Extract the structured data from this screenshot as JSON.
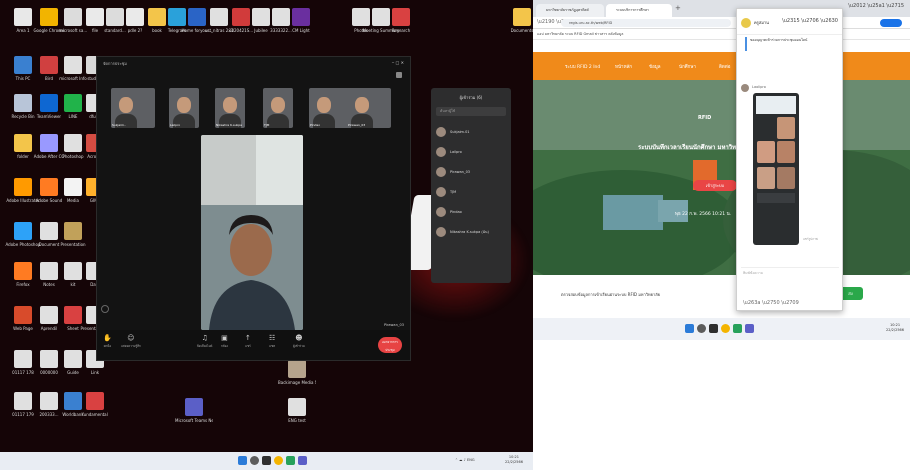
{
  "desktop_icons": [
    {
      "label": "Area 1",
      "color": "#e8e8e8"
    },
    {
      "label": "Google Chrome",
      "color": "#f2b400"
    },
    {
      "label": "microsoft sa...",
      "color": "#dcdcdc"
    },
    {
      "label": "file",
      "color": "#eaeaea"
    },
    {
      "label": "standard...",
      "color": "#dcdcdc"
    },
    {
      "label": "pdle 2?",
      "color": "#eaeaea"
    },
    {
      "label": "book",
      "color": "#f3c54a"
    },
    {
      "label": "Telegram",
      "color": "#2aa1da"
    },
    {
      "label": "Home foryour...",
      "color": "#2a64c6"
    },
    {
      "label": "ust_nitras 2x3",
      "color": "#e0e0e0"
    },
    {
      "label": "1020421S...",
      "color": "#d13b3b"
    },
    {
      "label": "Jubilee",
      "color": "#e0e0e0"
    },
    {
      "label": "3333322...",
      "color": "#e0e0e0"
    },
    {
      "label": "CM Light",
      "color": "#6a2f9f"
    },
    {
      "label": "This PC",
      "color": "#3a80d0"
    },
    {
      "label": "Bird",
      "color": "#d04040"
    },
    {
      "label": "microsoft Info",
      "color": "#e0e0e0"
    },
    {
      "label": "student",
      "color": "#d8d8d8"
    },
    {
      "label": "Recycle Bin",
      "color": "#b8c5d8"
    },
    {
      "label": "TeamViewer",
      "color": "#0e67d2"
    },
    {
      "label": "LINE",
      "color": "#21b34a"
    },
    {
      "label": "dfund",
      "color": "#e0e0e0"
    },
    {
      "label": "folder",
      "color": "#f3c54a"
    },
    {
      "label": "Adobe After CC",
      "color": "#9999ff"
    },
    {
      "label": "Photoshop",
      "color": "#e0e0e0"
    },
    {
      "label": "Acrobat",
      "color": "#d54c42"
    },
    {
      "label": "Adobe Illustrator",
      "color": "#ff9a00"
    },
    {
      "label": "Adobe Sound",
      "color": "#ff7b22"
    },
    {
      "label": "Media",
      "color": "#f3f3f3"
    },
    {
      "label": "GIMP",
      "color": "#ffb12c"
    },
    {
      "label": "Adobe Photoshop",
      "color": "#2da2f8"
    },
    {
      "label": "Document",
      "color": "#e0e0e0"
    },
    {
      "label": "Presentation",
      "color": "#c1a15a"
    },
    {
      "label": "Firefox",
      "color": "#ff7b22"
    },
    {
      "label": "Notes",
      "color": "#e0e0e0"
    },
    {
      "label": "kit",
      "color": "#e0e0e0"
    },
    {
      "label": "Data",
      "color": "#e0e0e0"
    },
    {
      "label": "Web Page",
      "color": "#d84b2b"
    },
    {
      "label": "Aprendil",
      "color": "#e0e0e0"
    },
    {
      "label": "Sheet",
      "color": "#d94141"
    },
    {
      "label": "Presentation 2",
      "color": "#e0e0e0"
    },
    {
      "label": "01117 178",
      "color": "#e0e0e0"
    },
    {
      "label": "0000000",
      "color": "#e0e0e0"
    },
    {
      "label": "Guide",
      "color": "#e0e0e0"
    },
    {
      "label": "Link",
      "color": "#e0e0e0"
    },
    {
      "label": "01117 179",
      "color": "#e0e0e0"
    },
    {
      "label": "200333...",
      "color": "#e0e0e0"
    },
    {
      "label": "Worldbank",
      "color": "#3a80d0"
    },
    {
      "label": "fundamental",
      "color": "#d94141"
    },
    {
      "label": "Backimage Media S...",
      "color": "#b5a38c"
    },
    {
      "label": "Microsoft Teams New",
      "color": "#5b5fc7"
    },
    {
      "label": "ENG test",
      "color": "#e0e0e0"
    },
    {
      "label": "Photos",
      "color": "#e0e0e0"
    },
    {
      "label": "Meeting Summary",
      "color": "#e0e0e0"
    },
    {
      "label": "Research",
      "color": "#d94141"
    },
    {
      "label": "Documents",
      "color": "#f3c54a"
    }
  ],
  "meeting": {
    "window_title": "จัดการประชุม",
    "win_ctrls": "‒  □  ✕",
    "participant_tiles": [
      {
        "name": "Sukjaim.."
      },
      {
        "name": "Lailpro"
      },
      {
        "name": "Nikashra K.sukpa"
      },
      {
        "name": "TJM"
      },
      {
        "name": "Pindao"
      },
      {
        "name": "Pirawan_03"
      }
    ],
    "main_speaker_label": "Pirawan_03",
    "controls": [
      {
        "icon": "✋",
        "label": "ยกมือ"
      },
      {
        "icon": "☺",
        "label": "แสดงความรู้สึก"
      },
      {
        "icon": "♫",
        "label": "ปิดเสียงไมค์"
      },
      {
        "icon": "▣",
        "label": "กล้อง"
      },
      {
        "icon": "↑",
        "label": "แชร์"
      },
      {
        "icon": "☷",
        "label": "แชท"
      },
      {
        "icon": "☻",
        "label": "ผู้เข้าร่วม"
      }
    ],
    "leave_label": "ออกจากการประชุม"
  },
  "participants_panel": {
    "title": "ผู้เข้าร่วม (6)",
    "search_placeholder": "ค้นหาผู้ใช้",
    "people": [
      {
        "name": "Sukjaim.01"
      },
      {
        "name": "Lailpro"
      },
      {
        "name": "Pirawan_03"
      },
      {
        "name": "TJM"
      },
      {
        "name": "Pindao"
      },
      {
        "name": "Nikashra K.sukpa (ฉัน)"
      }
    ]
  },
  "browser": {
    "tabs": [
      {
        "label": "มหาวิทยาลัยราชภัฏอุตรดิตถ์"
      },
      {
        "label": "ระบบบริการการศึกษา"
      }
    ],
    "url": "regis.uru.ac.th/web/RFID",
    "bookmarks": "แอป  มหาวิทยาลัย  ระบบ  RFID  Gmail  ข่าวสาร  คลังข้อมูล",
    "site_nav": [
      "ระบบ RFID 2 Ind",
      "หน้าหลัก",
      "ข้อมูล",
      "นักศึกษา",
      "ติดต่อ"
    ],
    "hero_text": "ระบบบันทึกเวลาเรียนนักศึกษา มหาวิทยาลัย",
    "hero_button": "เข้าสู่ระบบ",
    "hero_date": "พุธ 22 ก.พ. 2566 10:21 น.",
    "badge": "RFID",
    "footer_text": "ตรวจสอบข้อมูลการเข้าเรียนผ่านระบบ RFID มหาวิทยาลัย",
    "footer_btn": "ส่ง"
  },
  "chat": {
    "contact_name": "ครูสมาน",
    "snippet": "ขออนุญาตเข้าร่วมการประชุมออนไลน์",
    "sender": "Laolipro",
    "sent_caption": "แชร์รูปภาพ",
    "input_placeholder": "พิมพ์ข้อความ"
  },
  "taskbar": {
    "tray_time": "10:21",
    "tray_date": "22/2/2566",
    "right_time": "10:21",
    "right_date": "22/2/2566",
    "tray_icons": "⌃  ☁  ♪  ENG"
  },
  "colors": {
    "accent_orange": "#f08a1a",
    "leave_red": "#e74343",
    "taskbar": "#e9edf3"
  }
}
